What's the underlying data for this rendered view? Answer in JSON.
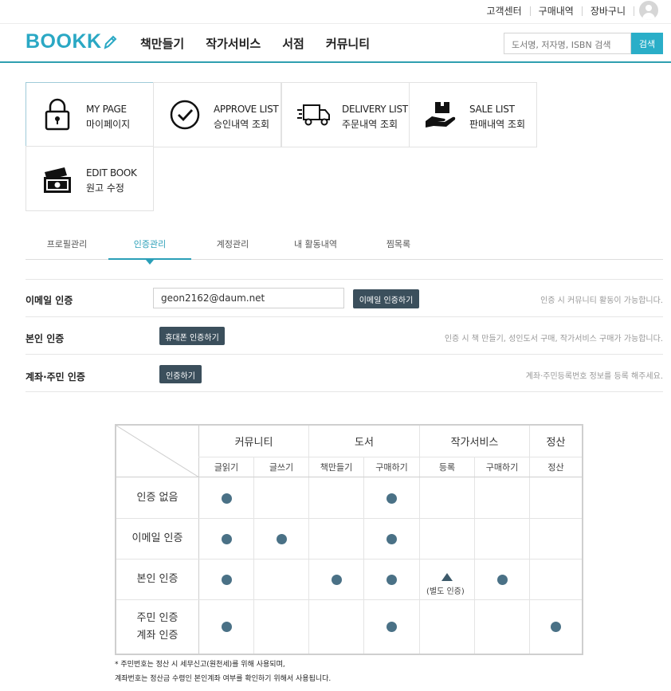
{
  "util": {
    "links": [
      "고객센터",
      "구매내역",
      "장바구니"
    ]
  },
  "header": {
    "logo": "BOOKK",
    "nav": [
      "책만들기",
      "작가서비스",
      "서점",
      "커뮤니티"
    ],
    "search_placeholder": "도서명, 저자명, ISBN 검색",
    "search_button": "검색"
  },
  "cards": [
    {
      "en": "MY PAGE",
      "ko": "마이페이지",
      "icon": "lock-icon"
    },
    {
      "en": "APPROVE LIST",
      "ko": "승인내역 조회",
      "icon": "check-circle-icon"
    },
    {
      "en": "DELIVERY LIST",
      "ko": "주문내역 조회",
      "icon": "truck-icon"
    },
    {
      "en": "SALE LIST",
      "ko": "판매내역 조회",
      "icon": "hand-box-icon"
    },
    {
      "en": "EDIT BOOK",
      "ko": "원고 수정",
      "icon": "money-icon"
    }
  ],
  "tabs": [
    "프로필관리",
    "인증관리",
    "계정관리",
    "내 활동내역",
    "찜목록"
  ],
  "auth": {
    "email": {
      "label": "이메일 인증",
      "value": "geon2162@daum.net",
      "button": "이메일 인증하기",
      "hint": "인증 시 커뮤니티 활동이 가능합니다."
    },
    "identity": {
      "label": "본인 인증",
      "button": "휴대폰 인증하기",
      "hint": "인증 시 책 만들기, 성인도서 구매, 작가서비스 구매가 가능합니다."
    },
    "account": {
      "label": "계좌·주민 인증",
      "button": "인증하기",
      "hint": "계좌·주민등록번호 정보를 등록 해주세요."
    }
  },
  "table": {
    "groups": [
      "커뮤니티",
      "도서",
      "작가서비스",
      "정산"
    ],
    "subs": [
      "글읽기",
      "글쓰기",
      "책만들기",
      "구매하기",
      "등록",
      "구매하기",
      "정산"
    ],
    "rows": [
      {
        "label": "인증 없음"
      },
      {
        "label": "이메일 인증"
      },
      {
        "label": "본인 인증"
      },
      {
        "label_line1": "주민 인증",
        "label_line2": "계좌 인증"
      }
    ],
    "marks": [
      [
        true,
        false,
        false,
        true,
        false,
        false,
        false
      ],
      [
        true,
        true,
        false,
        true,
        false,
        false,
        false
      ],
      [
        true,
        false,
        true,
        true,
        "triangle",
        true,
        false
      ],
      [
        true,
        false,
        false,
        true,
        false,
        false,
        true
      ]
    ],
    "triangle_note": "(별도 인증)",
    "dot_color": "#4a7186"
  },
  "footnotes": [
    "* 주민번호는 정산 시 세무신고(원천세)를 위해 사용되며,",
    "계좌번호는 정산금 수령인 본인계좌 여부를 확인하기 위해서 사용됩니다."
  ]
}
